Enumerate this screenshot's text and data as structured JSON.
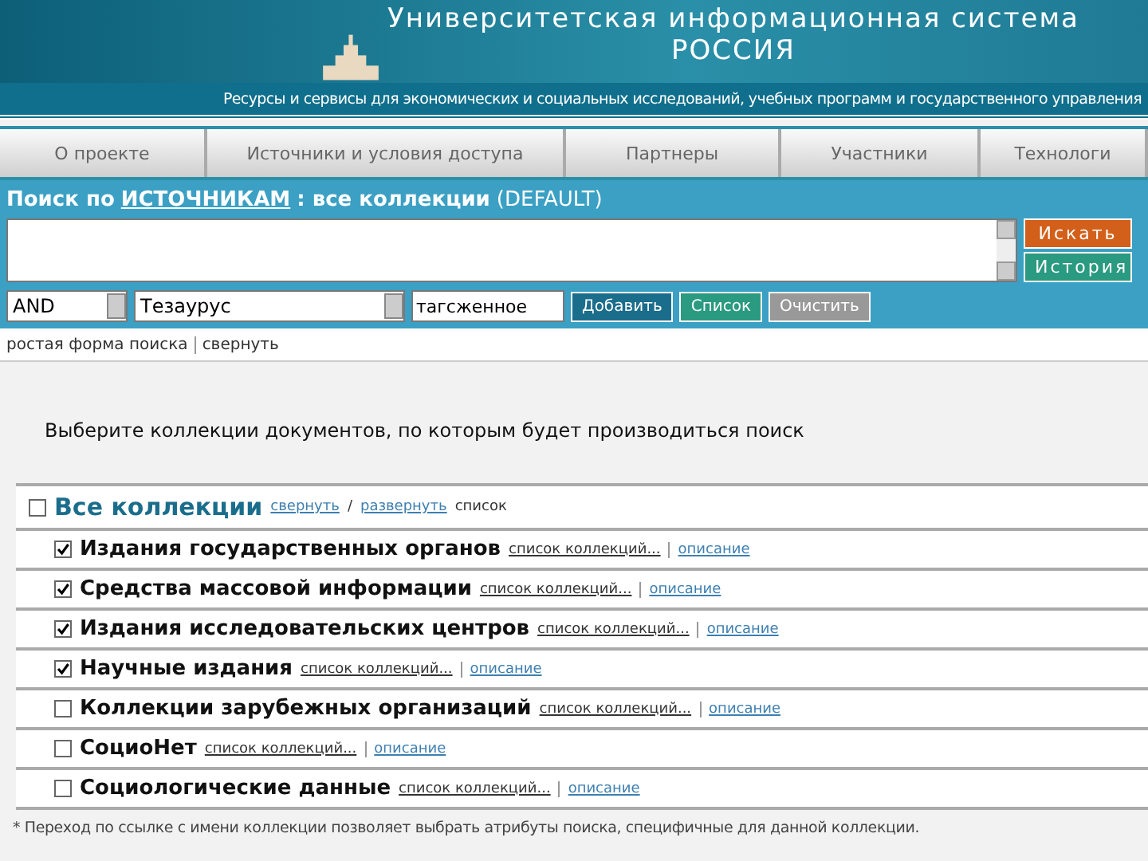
{
  "header": {
    "title": "Университетская информационная система",
    "subtitle": "РОССИЯ",
    "tagline": "Ресурсы и сервисы для экономических и социальных исследований, учебных программ и государственного управления"
  },
  "nav": [
    {
      "label": "О проекте"
    },
    {
      "label": "Источники и условия доступа"
    },
    {
      "label": "Партнеры"
    },
    {
      "label": "Участники"
    },
    {
      "label": "Технологи"
    }
  ],
  "search": {
    "title_prefix": "Поиск по",
    "title_link": "ИСТОЧНИКАМ",
    "title_suffix": ": все коллекции",
    "title_default": "(DEFAULT)",
    "search_button": "Искать",
    "history_button": "История",
    "operator": "AND",
    "field": "Тезаурус",
    "term": "тагсженное",
    "add_button": "Добавить",
    "list_button": "Список",
    "clear_button": "Очистить",
    "links": [
      "ростая форма поиска",
      "свернуть"
    ]
  },
  "collections": {
    "heading": "Выберите коллекции документов, по которым будет производиться поиск",
    "all": {
      "label": "Все коллекции",
      "checked": false,
      "collapse": "свернуть",
      "slash": "/",
      "expand": "развернуть",
      "suffix": "список"
    },
    "items": [
      {
        "label": "Издания государственных органов",
        "checked": true,
        "list_link": "список коллекций...",
        "desc_link": "описание"
      },
      {
        "label": "Средства массовой информации",
        "checked": true,
        "list_link": "список коллекций...",
        "desc_link": "описание"
      },
      {
        "label": "Издания исследовательских центров",
        "checked": true,
        "list_link": "список коллекций...",
        "desc_link": "описание"
      },
      {
        "label": "Научные издания",
        "checked": true,
        "list_link": "список коллекций...",
        "desc_link": "описание"
      },
      {
        "label": "Коллекции зарубежных организаций",
        "checked": false,
        "list_link": "список коллекций...",
        "desc_link": "описание"
      },
      {
        "label": "СоциоНет",
        "checked": false,
        "list_link": "список коллекций...",
        "desc_link": "описание"
      },
      {
        "label": "Социологические данные",
        "checked": false,
        "list_link": "список коллекций...",
        "desc_link": "описание"
      }
    ],
    "footnote": "* Переход по ссылке с имени коллекции позволяет выбрать атрибуты поиска, специфичные для данной коллекции."
  }
}
